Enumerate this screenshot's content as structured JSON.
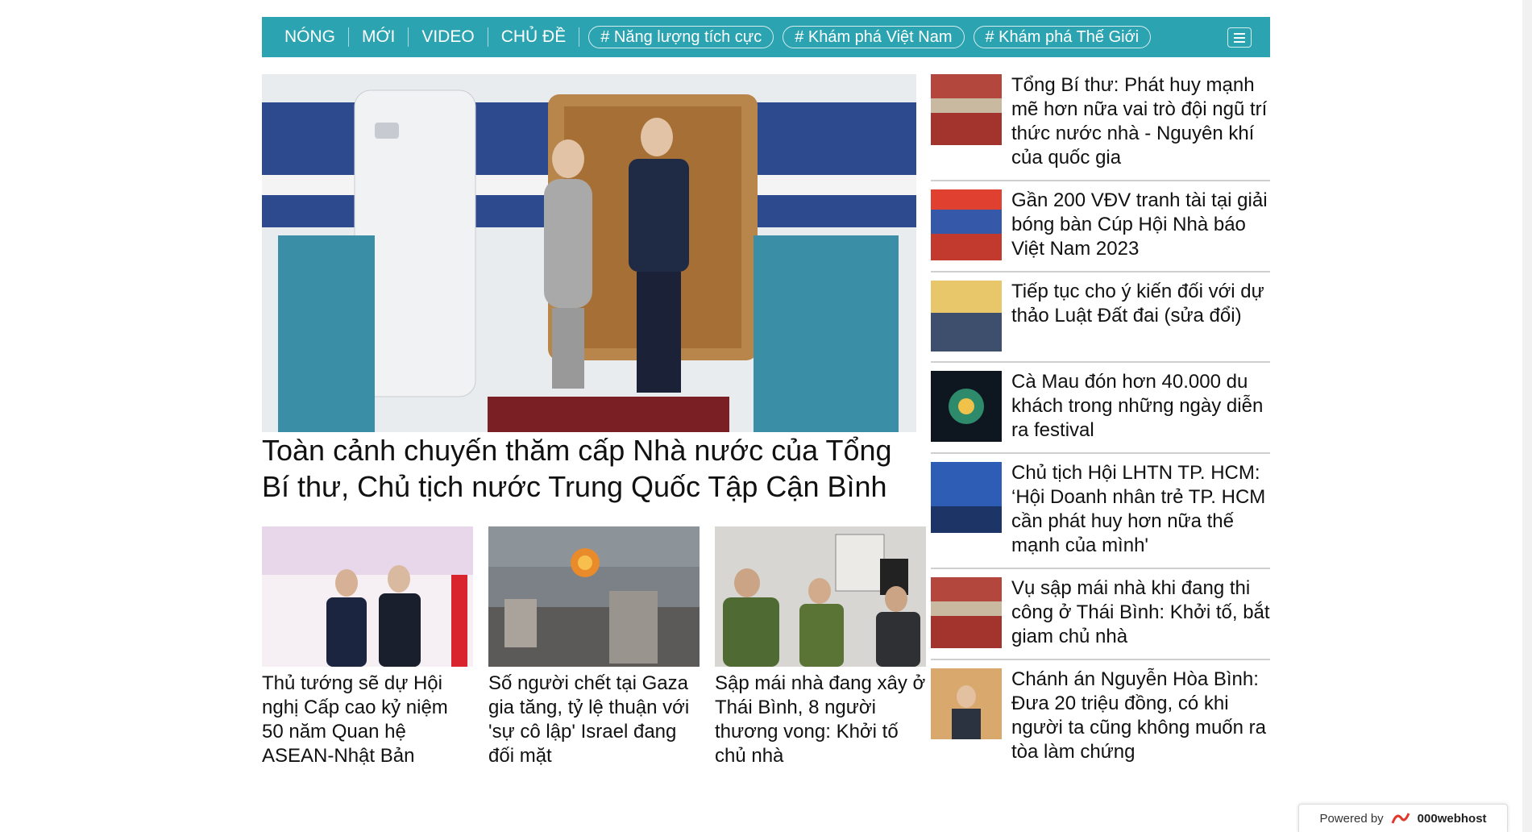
{
  "nav": {
    "items": [
      "NÓNG",
      "MỚI",
      "VIDEO",
      "CHỦ ĐỀ"
    ],
    "tags": [
      "# Năng lượng tích cực",
      "# Khám phá Việt Nam",
      "# Khám phá Thế Giới"
    ],
    "color": "#2ba3b0"
  },
  "hero": {
    "title": "Toàn cảnh chuyến thăm cấp Nhà nước của Tổng Bí thư, Chủ tịch nước Trung Quốc Tập Cận Bình"
  },
  "cards": [
    {
      "title": "Thủ tướng sẽ dự Hội nghị Cấp cao kỷ niệm 50 năm Quan hệ ASEAN-Nhật Bản"
    },
    {
      "title": "Số người chết tại Gaza gia tăng, tỷ lệ thuận với 'sự cô lập' Israel đang đối mặt"
    },
    {
      "title": "Sập mái nhà đang xây ở Thái Bình, 8 người thương vong: Khởi tố chủ nhà"
    }
  ],
  "side": [
    {
      "title": "Tổng Bí thư: Phát huy mạnh mẽ hơn nữa vai trò đội ngũ trí thức nước nhà - Nguyên khí của quốc gia"
    },
    {
      "title": "Gần 200 VĐV tranh tài tại giải bóng bàn Cúp Hội Nhà báo Việt Nam 2023"
    },
    {
      "title": "Tiếp tục cho ý kiến đối với dự thảo Luật Đất đai (sửa đổi)"
    },
    {
      "title": "Cà Mau đón hơn 40.000 du khách trong những ngày diễn ra festival"
    },
    {
      "title": "Chủ tịch Hội LHTN TP. HCM: ‘Hội Doanh nhân trẻ TP. HCM cần phát huy hơn nữa thế mạnh của mình'"
    },
    {
      "title": "Vụ sập mái nhà khi đang thi công ở Thái Bình: Khởi tố, bắt giam chủ nhà"
    },
    {
      "title": "Chánh án Nguyễn Hòa Bình: Đưa 20 triệu đồng, có khi người ta cũng không muốn ra tòa làm chứng"
    }
  ],
  "powered": {
    "label": "Powered by",
    "brand": "000webhost"
  }
}
